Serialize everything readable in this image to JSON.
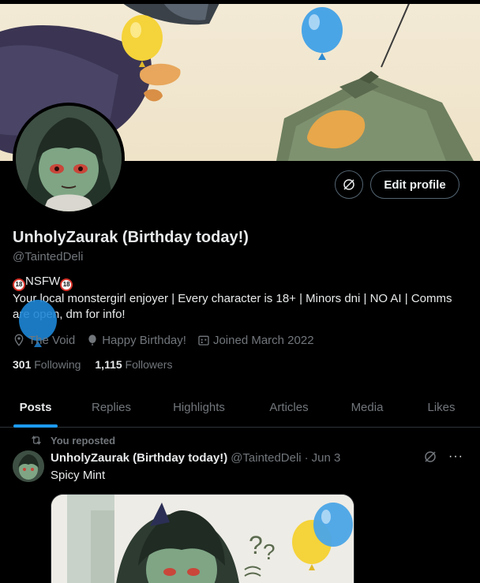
{
  "profile": {
    "display_name": "UnholyZaurak (Birthday today!)",
    "handle": "@TaintedDeli",
    "edit_button_label": "Edit profile",
    "bio_line1_badge": "18",
    "bio_line1_text": "NSFW",
    "bio_line1_badge_end": "18",
    "bio_text": "Your local monstergirl enjoyer | Every character is 18+ | Minors dni | NO AI | Comms are open, dm for info!",
    "location": "The Void",
    "birthday": "Happy Birthday!",
    "joined": "Joined March 2022",
    "following_count": "301",
    "following_label": "Following",
    "followers_count": "1,115",
    "followers_label": "Followers"
  },
  "tabs": [
    {
      "label": "Posts",
      "active": true
    },
    {
      "label": "Replies"
    },
    {
      "label": "Highlights"
    },
    {
      "label": "Articles"
    },
    {
      "label": "Media"
    },
    {
      "label": "Likes"
    }
  ],
  "feed": {
    "repost_label": "You reposted",
    "post": {
      "author_name": "UnholyZaurak (Birthday today!)",
      "author_handle": "@TaintedDeli",
      "separator": "·",
      "date": "Jun 3",
      "text": "Spicy Mint",
      "more_label": "···"
    }
  },
  "colors": {
    "accent": "#1d9bf0",
    "background": "#000000",
    "secondary_text": "#71767b",
    "balloon_blue": "#4aa5e6",
    "balloon_yellow": "#f5d33a"
  },
  "icons": {
    "location": "location-pin-icon",
    "birthday": "balloon-icon",
    "joined": "calendar-icon",
    "repost": "repost-icon",
    "grok": "grok-icon",
    "more": "more-icon"
  }
}
